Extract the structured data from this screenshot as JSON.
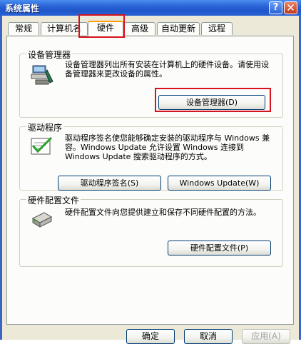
{
  "window": {
    "title": "系统属性",
    "help_glyph": "?",
    "close_glyph": "✕"
  },
  "tabs": [
    {
      "label": "常规"
    },
    {
      "label": "计算机名"
    },
    {
      "label": "硬件",
      "active": true
    },
    {
      "label": "高级"
    },
    {
      "label": "自动更新"
    },
    {
      "label": "远程"
    }
  ],
  "device_manager": {
    "title": "设备管理器",
    "description": "设备管理器列出所有安装在计算机上的硬件设备。请使用设备管理器来更改设备的属性。",
    "button_label": "设备管理器(D)"
  },
  "drivers": {
    "title": "驱动程序",
    "description": "驱动程序签名使您能够确定安装的驱动程序与 Windows 兼容。Windows Update 允许设置 Windows 连接到 Windows Update 搜索驱动程序的方式。",
    "signing_button": "驱动程序签名(S)",
    "update_button": "Windows Update(W)"
  },
  "hardware_profiles": {
    "title": "硬件配置文件",
    "description": "硬件配置文件向您提供建立和保存不同硬件配置的方法。",
    "button_label": "硬件配置文件(P)"
  },
  "footer": {
    "ok": "确定",
    "cancel": "取消",
    "apply": "应用(A)"
  },
  "colors": {
    "title_bar": "#2a63d6",
    "highlight_frame": "#d8121c",
    "dialog_bg": "#ece9d8"
  }
}
